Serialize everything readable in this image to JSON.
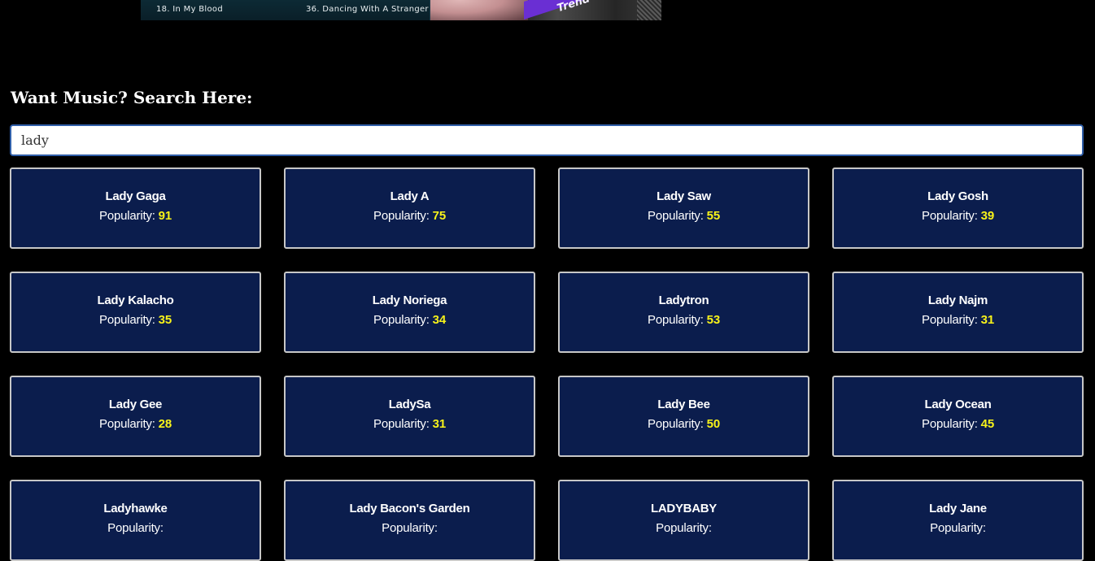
{
  "banner": {
    "track_left": "18. In My Blood",
    "track_right": "36. Dancing With A Stranger",
    "stripe_text": "Trend"
  },
  "search": {
    "heading": "Want Music? Search Here:",
    "value": "lady"
  },
  "popularity_label": "Popularity: ",
  "results": [
    {
      "name": "Lady Gaga",
      "popularity": "91"
    },
    {
      "name": "Lady A",
      "popularity": "75"
    },
    {
      "name": "Lady Saw",
      "popularity": "55"
    },
    {
      "name": "Lady Gosh",
      "popularity": "39"
    },
    {
      "name": "Lady Kalacho",
      "popularity": "35"
    },
    {
      "name": "Lady Noriega",
      "popularity": "34"
    },
    {
      "name": "Ladytron",
      "popularity": "53"
    },
    {
      "name": "Lady Najm",
      "popularity": "31"
    },
    {
      "name": "Lady Gee",
      "popularity": "28"
    },
    {
      "name": "LadySa",
      "popularity": "31"
    },
    {
      "name": "Lady Bee",
      "popularity": "50"
    },
    {
      "name": "Lady Ocean",
      "popularity": "45"
    },
    {
      "name": "Ladyhawke",
      "popularity": ""
    },
    {
      "name": "Lady Bacon's Garden",
      "popularity": ""
    },
    {
      "name": "LADYBABY",
      "popularity": ""
    },
    {
      "name": "Lady Jane",
      "popularity": ""
    }
  ],
  "colors": {
    "page_background": "#000000",
    "card_background": "#0b1d4d",
    "card_border": "#c7c7c7",
    "popularity_value": "#f7f21a",
    "input_border": "#2f5ea8"
  }
}
